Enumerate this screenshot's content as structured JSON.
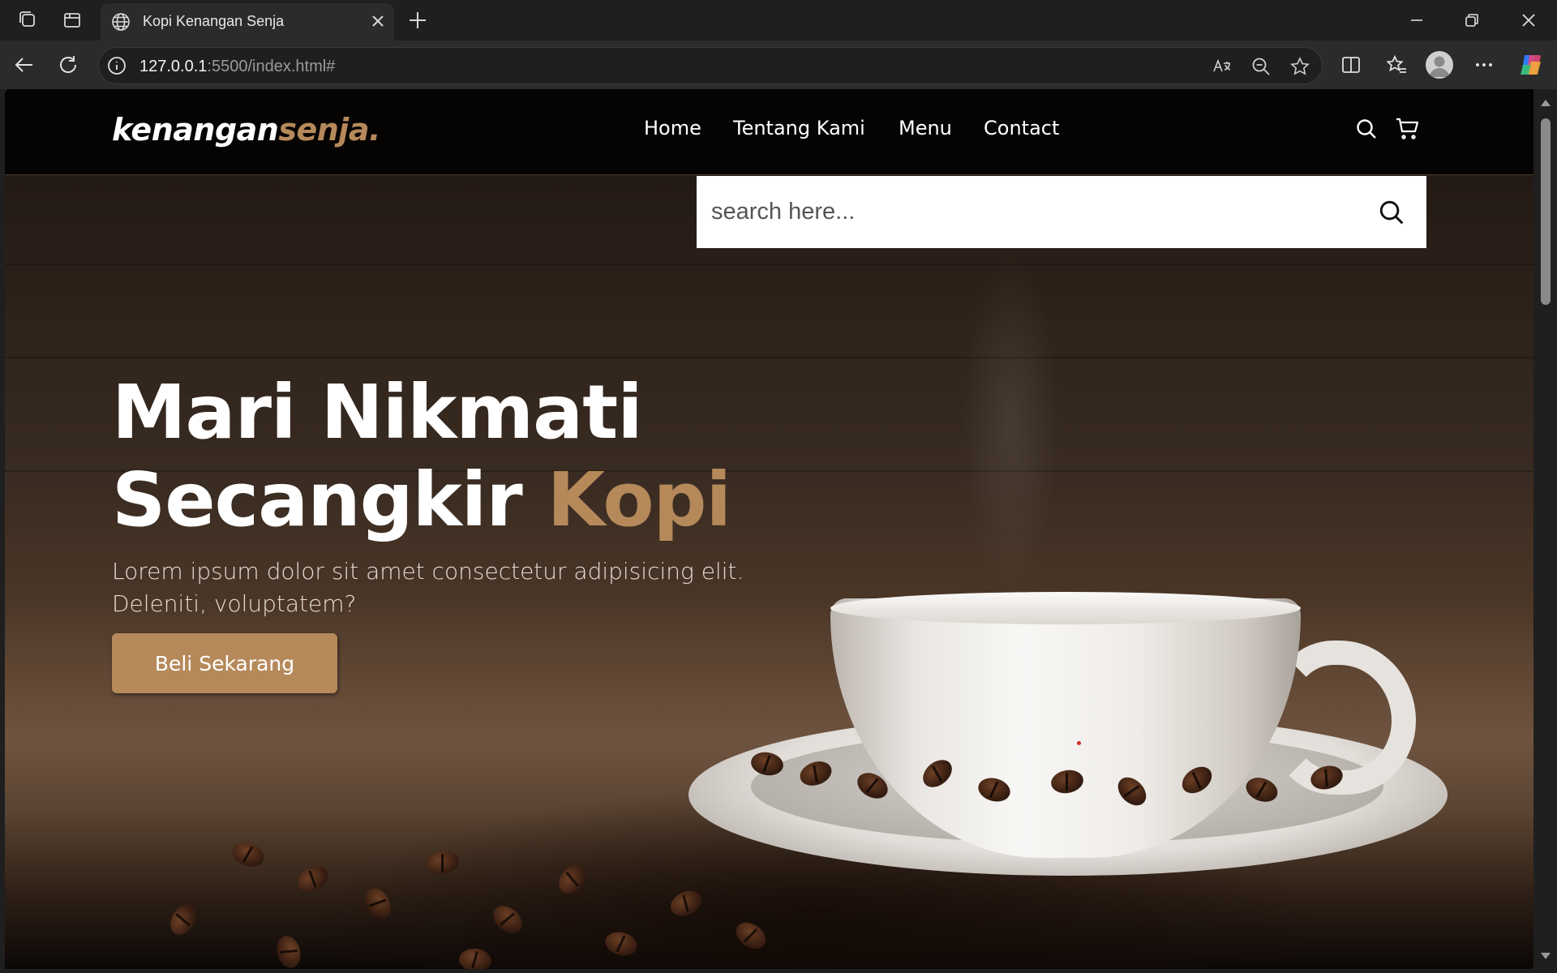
{
  "browser": {
    "tab": {
      "title": "Kopi Kenangan Senja",
      "favicon": "globe-icon"
    },
    "url": {
      "host": "127.0.0.1",
      "rest": ":5500/index.html#"
    },
    "toolbar_icons": [
      "back-icon",
      "refresh-icon",
      "info-icon",
      "read-aloud-icon",
      "zoom-out-icon",
      "favorite-star-icon",
      "split-screen-icon",
      "favorites-icon",
      "profile-avatar",
      "more-icon",
      "copilot-icon"
    ]
  },
  "site": {
    "logo": {
      "main": "kenangan",
      "accent": "senja."
    },
    "nav": [
      {
        "label": "Home"
      },
      {
        "label": "Tentang Kami"
      },
      {
        "label": "Menu"
      },
      {
        "label": "Contact"
      }
    ],
    "search": {
      "placeholder": "search here...",
      "value": ""
    },
    "hero": {
      "title_line1": "Mari Nikmati",
      "title_line2_main": "Secangkir ",
      "title_line2_accent": "Kopi",
      "text": "Lorem ipsum dolor sit amet consectetur adipisicing elit. Deleniti, voluptatem?",
      "cta": "Beli Sekarang"
    },
    "colors": {
      "accent": "#b6895b",
      "navbar": "#000000",
      "text": "#ffffff"
    }
  }
}
